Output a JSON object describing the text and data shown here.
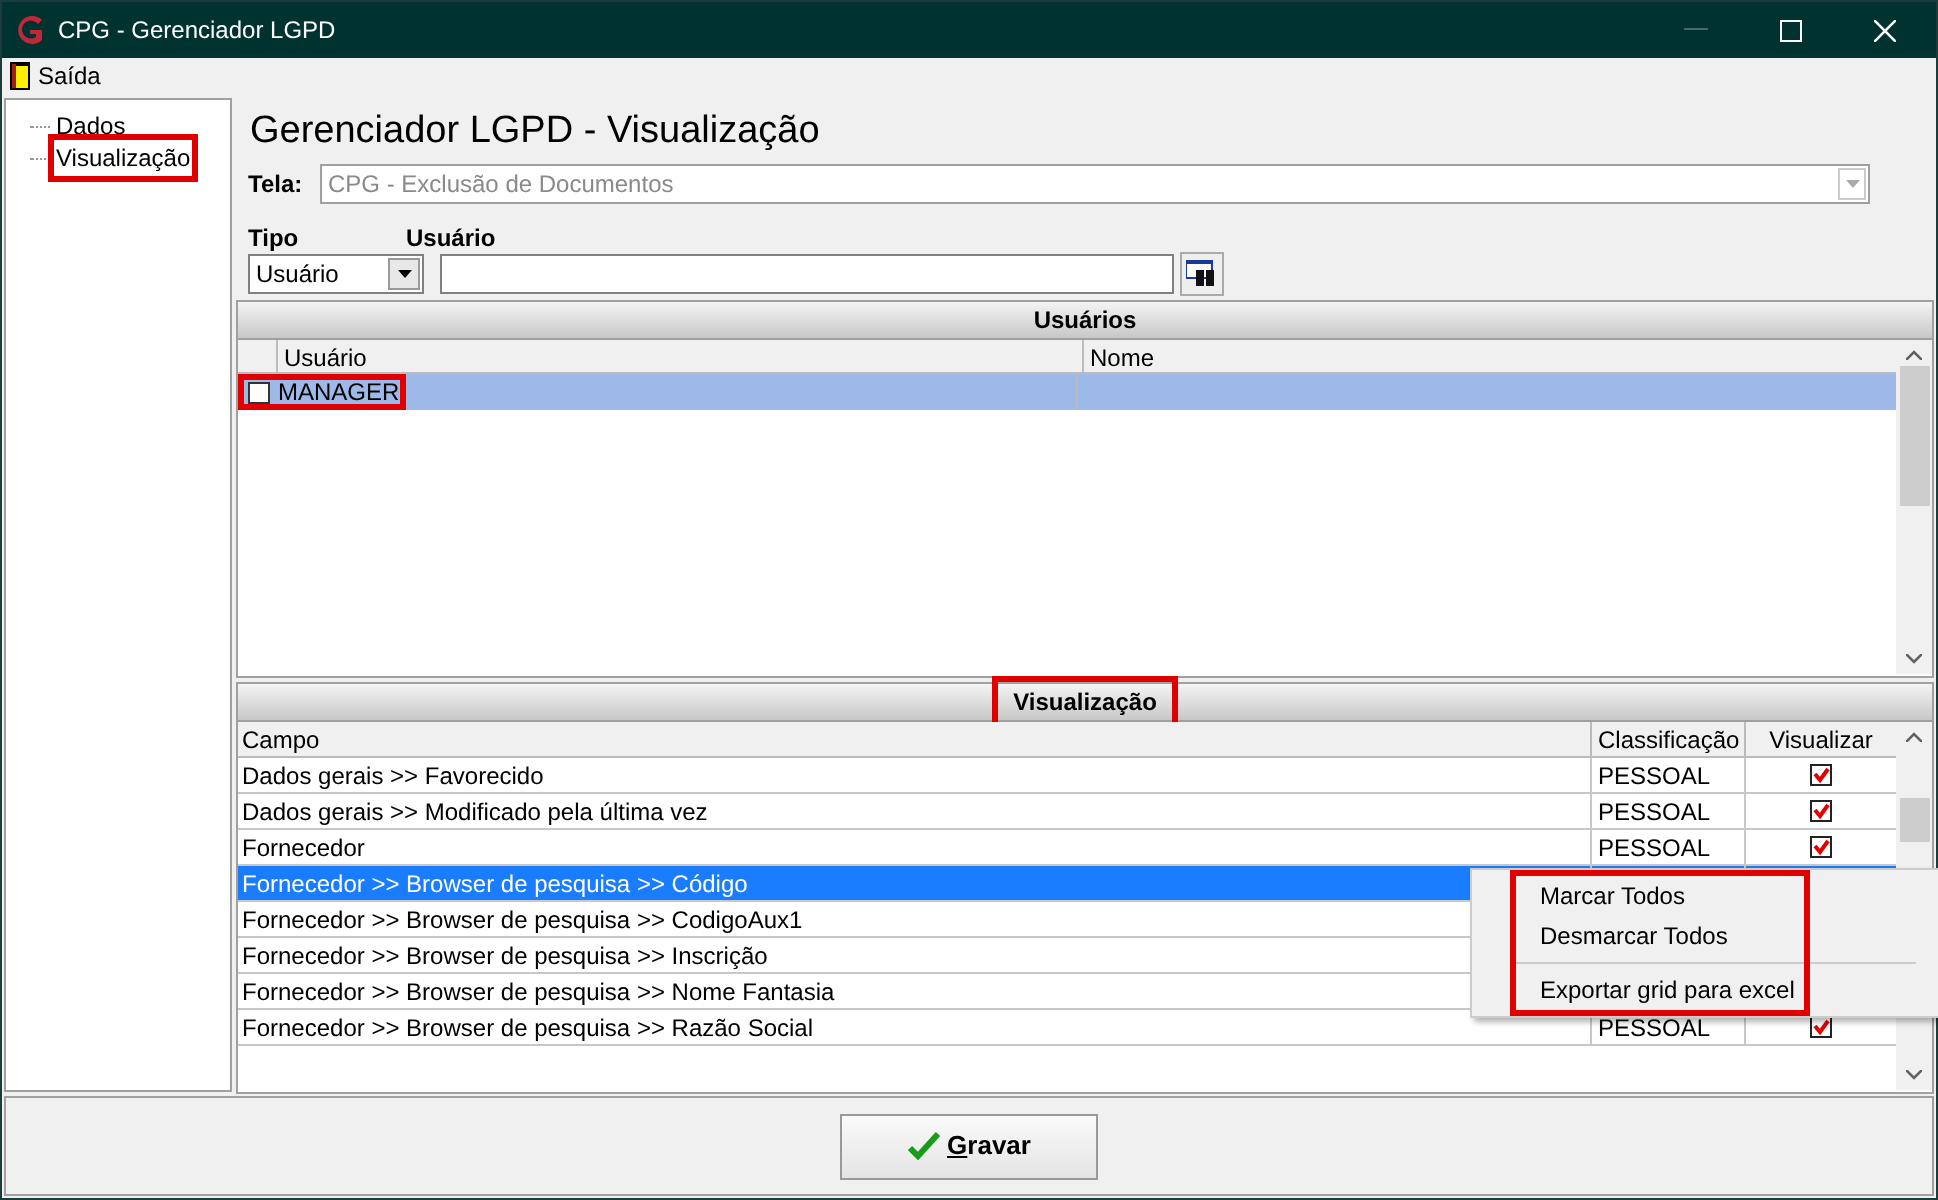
{
  "window": {
    "title": "CPG - Gerenciador LGPD"
  },
  "menu": [
    {
      "label": "Saída"
    }
  ],
  "tree": [
    {
      "label": "Dados",
      "annotated": false
    },
    {
      "label": "Visualização",
      "annotated": true
    }
  ],
  "heading": "Gerenciador LGPD - Visualização",
  "tela": {
    "label": "Tela:",
    "value": "CPG - Exclusão de Documentos",
    "disabled": true
  },
  "filter": {
    "tipo_label": "Tipo",
    "tipo_value": "Usuário",
    "usuario_label": "Usuário"
  },
  "users_panel": {
    "title": "Usuários",
    "columns": [
      "Usuário",
      "Nome"
    ],
    "rows": [
      {
        "usuario": "MANAGER",
        "nome": "",
        "checked": false,
        "selected": true,
        "annotated": true
      }
    ]
  },
  "view_panel": {
    "title": "Visualização",
    "annotated": true,
    "columns": [
      "Campo",
      "Classificação",
      "Visualizar"
    ],
    "rows": [
      {
        "campo": "Dados gerais >> Favorecido",
        "classificacao": "PESSOAL",
        "visualizar": true,
        "selected": false
      },
      {
        "campo": "Dados gerais >> Modificado pela última vez",
        "classificacao": "PESSOAL",
        "visualizar": true,
        "selected": false
      },
      {
        "campo": "Fornecedor",
        "classificacao": "PESSOAL",
        "visualizar": true,
        "selected": false
      },
      {
        "campo": "Fornecedor >> Browser de pesquisa >> Código",
        "selected": true
      },
      {
        "campo": "Fornecedor >> Browser de pesquisa >> CodigoAux1",
        "selected": false
      },
      {
        "campo": "Fornecedor >> Browser de pesquisa >> Inscrição",
        "selected": false
      },
      {
        "campo": "Fornecedor >> Browser de pesquisa >> Nome Fantasia",
        "selected": false
      },
      {
        "campo": "Fornecedor >> Browser de pesquisa >> Razão Social",
        "classificacao": "PESSOAL",
        "visualizar": true,
        "selected": false
      }
    ]
  },
  "context_menu": {
    "annotated": true,
    "items": [
      {
        "kind": "item",
        "label": "Marcar Todos"
      },
      {
        "kind": "item",
        "label": "Desmarcar Todos"
      },
      {
        "kind": "separator"
      },
      {
        "kind": "item",
        "label": "Exportar grid para excel"
      }
    ]
  },
  "save_button": {
    "accelerator": "G",
    "label_rest": "ravar"
  }
}
